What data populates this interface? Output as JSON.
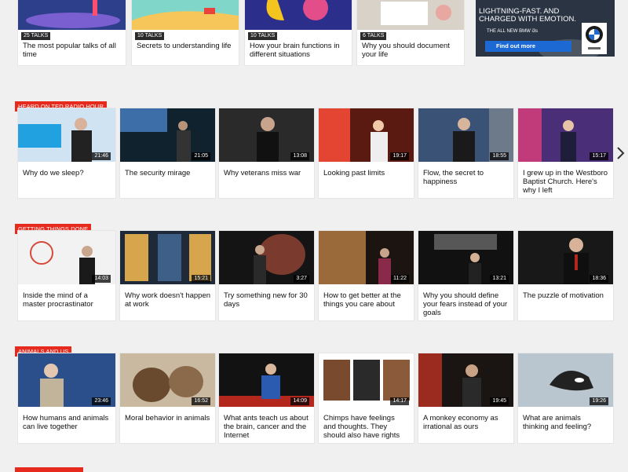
{
  "colors": {
    "accent": "#e62b1e",
    "background": "#f0f0f0",
    "card": "#ffffff",
    "ad_button": "#1c69d4"
  },
  "top_playlists": [
    {
      "badge": "25 TALKS",
      "title": "The most popular talks of all time"
    },
    {
      "badge": "10 TALKS",
      "title": "Secrets to understanding life"
    },
    {
      "badge": "10 TALKS",
      "title": "How your brain functions in different situations"
    },
    {
      "badge": "6 TALKS",
      "title": "Why you should document your life"
    }
  ],
  "ad": {
    "headline": "LIGHTNING-FAST. AND CHARGED WITH EMOTION.",
    "subline": "THE ALL NEW BMW i3s",
    "button": "Find out more",
    "logo_icon": "bmw-logo-icon"
  },
  "sections": [
    {
      "label": "HEARD ON TED RADIO HOUR",
      "talks": [
        {
          "title": "Why do we sleep?",
          "duration": "21:46"
        },
        {
          "title": "The security mirage",
          "duration": "21:05"
        },
        {
          "title": "Why veterans miss war",
          "duration": "13:08"
        },
        {
          "title": "Looking past limits",
          "duration": "19:17"
        },
        {
          "title": "Flow, the secret to happiness",
          "duration": "18:55"
        },
        {
          "title": "I grew up in the Westboro Baptist Church. Here's why I left",
          "duration": "15:17"
        }
      ]
    },
    {
      "label": "GETTING THINGS DONE",
      "talks": [
        {
          "title": "Inside the mind of a master procrastinator",
          "duration": "14:03"
        },
        {
          "title": "Why work doesn't happen at work",
          "duration": "15:21"
        },
        {
          "title": "Try something new for 30 days",
          "duration": "3:27"
        },
        {
          "title": "How to get better at the things you care about",
          "duration": "11:22"
        },
        {
          "title": "Why you should define your fears instead of your goals",
          "duration": "13:21"
        },
        {
          "title": "The puzzle of motivation",
          "duration": "18:36"
        }
      ]
    },
    {
      "label": "ANIMALS AND US",
      "talks": [
        {
          "title": "How humans and animals can live together",
          "duration": "23:46"
        },
        {
          "title": "Moral behavior in animals",
          "duration": "16:52"
        },
        {
          "title": "What ants teach us about the brain, cancer and the Internet",
          "duration": "14:09"
        },
        {
          "title": "Chimps have feelings and thoughts. They should also have rights",
          "duration": "14:17"
        },
        {
          "title": "A monkey economy as irrational as ours",
          "duration": "19:45"
        },
        {
          "title": "What are animals thinking and feeling?",
          "duration": "19:26"
        }
      ]
    }
  ],
  "thumb_art": {
    "top": [
      [
        "#2d3f8a",
        "#7a5fd0",
        "#ff4f6f"
      ],
      [
        "#7fd6c9",
        "#f6c65a",
        "#e8423b"
      ],
      [
        "#2c2e8c",
        "#f4c51e",
        "#e34d8a"
      ],
      [
        "#d9d2c8",
        "#e8a7a1",
        "#ffffff"
      ]
    ],
    "rows": [
      [
        [
          "#cfe3f2",
          "#22a1e0"
        ],
        [
          "#11222f",
          "#3e6ea8"
        ],
        [
          "#2a2a2a",
          "#8a7a6a"
        ],
        [
          "#5a1a12",
          "#e34532"
        ],
        [
          "#3a5276",
          "#6d7a8a"
        ],
        [
          "#4a2e78",
          "#c13a79"
        ]
      ],
      [
        [
          "#f2f2f2",
          "#d64a3a"
        ],
        [
          "#1e2a3a",
          "#d7a64c"
        ],
        [
          "#141414",
          "#7a3a2e"
        ],
        [
          "#1c1410",
          "#9a6a3a"
        ],
        [
          "#111111",
          "#575757"
        ],
        [
          "#181818",
          "#b3271d"
        ]
      ],
      [
        [
          "#2a4f8a",
          "#c2b49a"
        ],
        [
          "#c9b9a0",
          "#6a4a2e"
        ],
        [
          "#121212",
          "#2b5bb0"
        ],
        [
          "#ffffff",
          "#7a4a2e"
        ],
        [
          "#1a1412",
          "#9a2b1e"
        ],
        [
          "#b9c6cf",
          "#222222"
        ]
      ]
    ]
  }
}
